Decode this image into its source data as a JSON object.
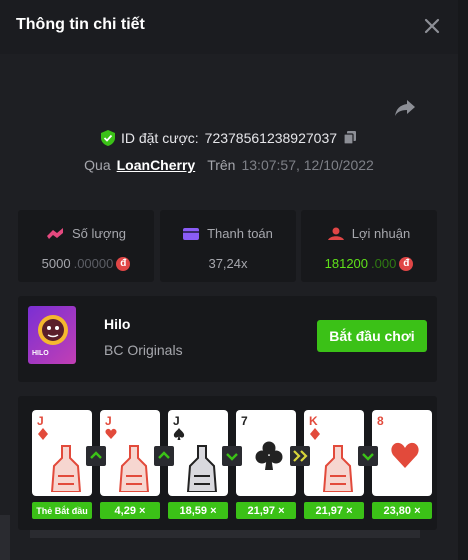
{
  "header": {
    "title": "Thông tin chi tiết"
  },
  "bet": {
    "id_label": "ID đặt cược:",
    "id_value": "7237856123892703​7"
  },
  "by": {
    "via": "Qua",
    "user": "LoanCherry",
    "on": "Trên",
    "time": "13:07:57, 12/10/2022"
  },
  "stats": [
    {
      "label": "Số lượng",
      "value_main": "5000",
      "value_dec": ".00000",
      "icon": "coins-icon",
      "coin": "đ"
    },
    {
      "label": "Thanh toán",
      "value_main": "37,24x",
      "value_dec": "",
      "icon": "card-icon",
      "coin": ""
    },
    {
      "label": "Lợi nhuận",
      "value_main": "181200",
      "value_dec": ".000",
      "icon": "profit-icon",
      "coin": "đ"
    }
  ],
  "game": {
    "name": "Hilo",
    "provider": "BC Originals",
    "play_label": "Bắt đầu chơi",
    "thumb_label": "HILO"
  },
  "cards": [
    {
      "rank": "J",
      "suit": "diamond",
      "color": "#e24a3b",
      "mult": "Thẻ Bắt đầu",
      "arrow": "up"
    },
    {
      "rank": "J",
      "suit": "heart",
      "color": "#e24a3b",
      "mult": "4,29 ×",
      "arrow": "up"
    },
    {
      "rank": "J",
      "suit": "spade",
      "color": "#222",
      "mult": "18,59 ×",
      "arrow": "down"
    },
    {
      "rank": "7",
      "suit": "club",
      "color": "#222",
      "mult": "21,97 ×",
      "arrow": "skip"
    },
    {
      "rank": "K",
      "suit": "diamond",
      "color": "#e24a3b",
      "mult": "21,97 ×",
      "arrow": "down"
    },
    {
      "rank": "8",
      "suit": "heart",
      "color": "#e24a3b",
      "mult": "23,80 ×",
      "arrow": ""
    }
  ],
  "colors": {
    "accent_green": "#3bc117",
    "profit_green": "#5fe01a",
    "coin_red": "#e04646",
    "panel": "#17181b",
    "modal": "#1e1f23"
  }
}
